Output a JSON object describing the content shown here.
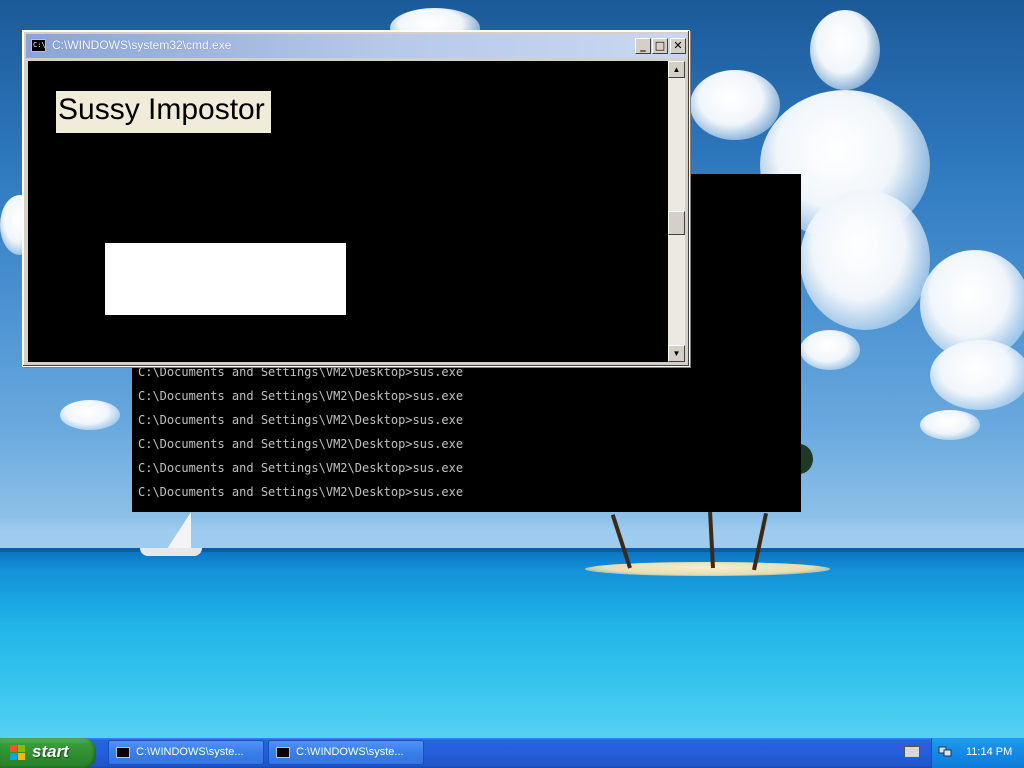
{
  "front_window": {
    "title": "C:\\WINDOWS\\system32\\cmd.exe",
    "icon": "cmd-icon",
    "icon_text": "C:\\",
    "label_text": "Sussy Impostor",
    "buttons": {
      "minimize": "_",
      "maximize": "□",
      "close": "✕"
    },
    "scroll_up": "▲",
    "scroll_down": "▼"
  },
  "back_window": {
    "lines": [
      "C:\\Documents and Settings\\VM2\\Desktop>sus.exe",
      "C:\\Documents and Settings\\VM2\\Desktop>sus.exe",
      "C:\\Documents and Settings\\VM2\\Desktop>sus.exe",
      "C:\\Documents and Settings\\VM2\\Desktop>sus.exe",
      "C:\\Documents and Settings\\VM2\\Desktop>sus.exe",
      "C:\\Documents and Settings\\VM2\\Desktop>sus.exe"
    ]
  },
  "taskbar": {
    "start_label": "start",
    "items": [
      {
        "label": "C:\\WINDOWS\\syste...",
        "icon": "cmd-icon"
      },
      {
        "label": "C:\\WINDOWS\\syste...",
        "icon": "cmd-icon"
      }
    ],
    "tray": {
      "clock": "11:14 PM",
      "icons": [
        "keyboard-icon",
        "network-icon"
      ]
    }
  },
  "colors": {
    "taskbar_blue": "#245edb",
    "start_green": "#3c9b3c",
    "titlebar_inactive": "#b7c9ea",
    "console_bg": "#000000"
  }
}
